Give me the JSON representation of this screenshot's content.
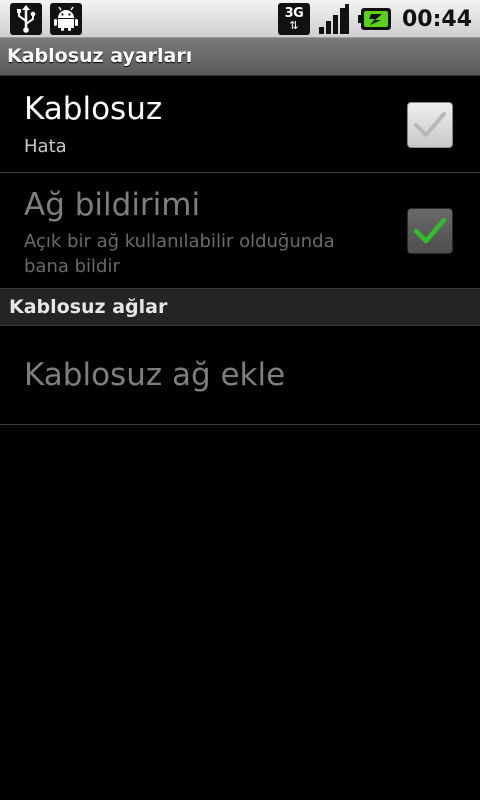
{
  "status_bar": {
    "icons_left": [
      "usb-icon",
      "android-debug-icon"
    ],
    "network_type": "3G",
    "time": "00:44"
  },
  "title_bar": {
    "title": "Kablosuz ayarları"
  },
  "preferences": [
    {
      "title": "Kablosuz",
      "summary": "Hata",
      "checked": false,
      "enabled": true
    },
    {
      "title": "Ağ bildirimi",
      "summary_line1": "Açık bir ağ kullanılabilir olduğunda",
      "summary_line2": "bana bildir",
      "checked": true,
      "enabled": false
    }
  ],
  "section": {
    "title": "Kablosuz ağlar"
  },
  "add_network": {
    "label": "Kablosuz ağ ekle"
  },
  "colors": {
    "check_green": "#2fbf2a",
    "check_gray": "#b8b8b8"
  }
}
